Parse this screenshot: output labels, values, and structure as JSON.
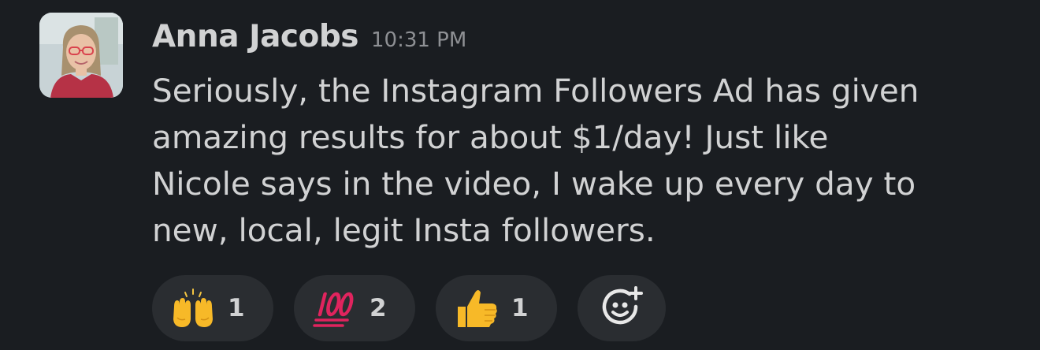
{
  "message": {
    "author": "Anna Jacobs",
    "timestamp": "10:31 PM",
    "lines": [
      "Seriously, the Instagram Followers Ad has given",
      "amazing results for about $1/day! Just like",
      "Nicole says in the video, I wake up every day to",
      "new, local, legit Insta followers."
    ]
  },
  "reactions": [
    {
      "icon": "raised-hands-icon",
      "count": "1"
    },
    {
      "icon": "hundred-points-icon",
      "count": "2"
    },
    {
      "icon": "thumbs-up-icon",
      "count": "1"
    }
  ],
  "add_reaction": {
    "icon": "add-reaction-icon"
  },
  "colors": {
    "background": "#1a1d21",
    "text": "#d1d2d3",
    "timestamp": "#8e9094",
    "pill": "#2a2d31"
  }
}
